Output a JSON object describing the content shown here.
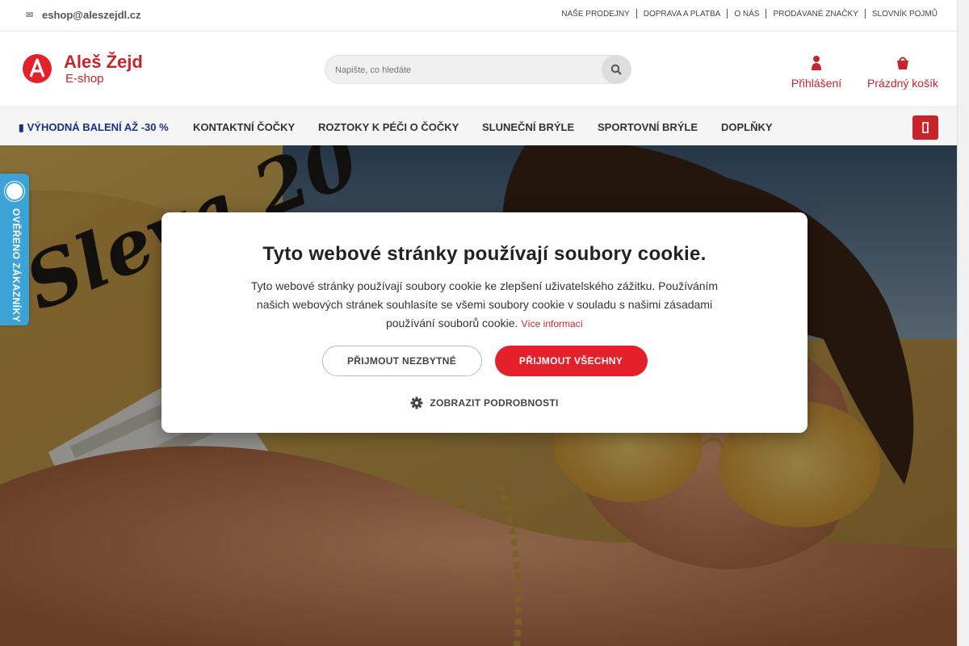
{
  "topbar": {
    "email": "eshop@aleszejdl.cz",
    "links": [
      "NAŠE PRODEJNY",
      "DOPRAVA A PLATBA",
      "O NÁS",
      "PRODÁVANÉ ZNAČKY",
      "SLOVNÍK POJMŮ"
    ]
  },
  "header": {
    "logo_name": "Aleš Žejdl",
    "logo_sub": "E-shop",
    "search_placeholder": "Napište, co hledáte",
    "login_label": "Přihlášení",
    "cart_label": "Prázdný košík"
  },
  "nav": {
    "promo": "VÝHODNÁ BALENÍ AŽ -30 %",
    "items": [
      "KONTAKTNÍ ČOČKY",
      "ROZTOKY K PÉČI O ČOČKY",
      "SLUNEČNÍ BRÝLE",
      "SPORTOVNÍ BRÝLE",
      "DOPLŇKY"
    ]
  },
  "hero": {
    "script_text": "Sleva 20"
  },
  "badge": {
    "text": "OVĚŘENO ZÁKAZNÍKY"
  },
  "cookie": {
    "title": "Tyto webové stránky používají soubory cookie.",
    "text": "Tyto webové stránky používají soubory cookie ke zlepšení uživatelského zážitku. Používáním našich webových stránek souhlasíte se všemi soubory cookie v souladu s našimi zásadami používání souborů cookie.",
    "more_link": "Více informací",
    "btn_necessary": "PŘIJMOUT NEZBYTNÉ",
    "btn_all": "PŘIJMOUT VŠECHNY",
    "details": "ZOBRAZIT PODROBNOSTI"
  },
  "colors": {
    "brand_red": "#c8242b",
    "accept_red": "#e4202b",
    "promo_blue": "#1a2f86",
    "badge_blue": "#3da3d6"
  }
}
